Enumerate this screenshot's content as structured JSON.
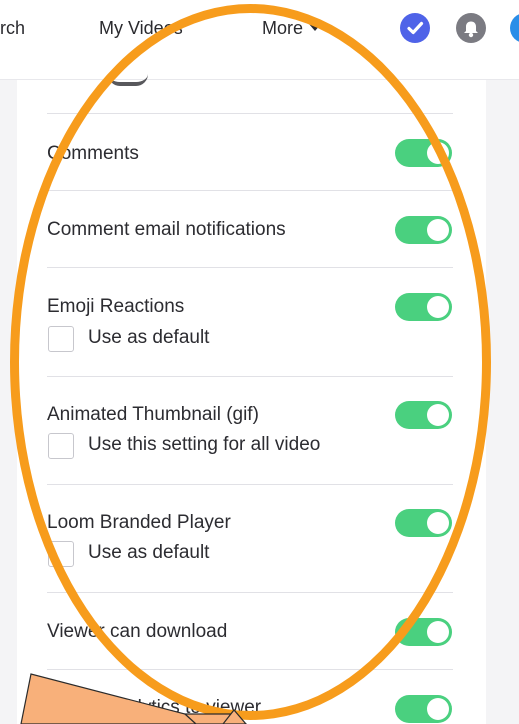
{
  "nav": {
    "search_fragment": "rch",
    "my_videos": "My Videos",
    "more": "More"
  },
  "icons": {
    "check": "check-circle-icon",
    "bell": "bell-icon",
    "avatar": "avatar-icon"
  },
  "settings": {
    "comments": "Comments",
    "comment_email_notifications": "Comment email notifications",
    "emoji_reactions": "Emoji Reactions",
    "emoji_default": "Use as default",
    "animated_thumbnail": "Animated Thumbnail (gif)",
    "animated_thumbnail_default": "Use this setting for all video",
    "loom_branded_player": "Loom Branded Player",
    "branded_player_default": "Use as default",
    "viewer_can_download": "Viewer can download",
    "analytics_to_viewer": "alytics to viewer"
  },
  "colors": {
    "toggle_on": "#4ad07f",
    "annotation": "#f79c1c",
    "arrow_fill": "#f8b07a"
  }
}
